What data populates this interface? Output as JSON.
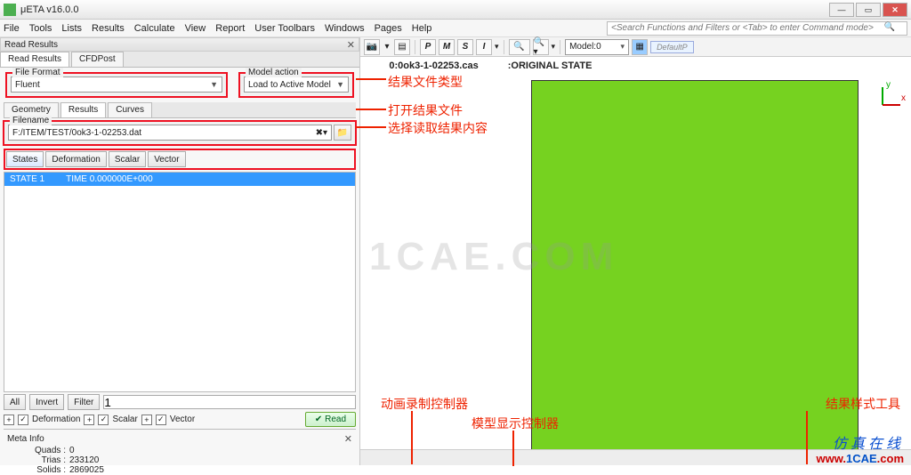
{
  "window": {
    "title": "μETA v16.0.0"
  },
  "menubar": {
    "items": [
      "File",
      "Tools",
      "Lists",
      "Results",
      "Calculate",
      "View",
      "Report",
      "User Toolbars",
      "Windows",
      "Pages",
      "Help"
    ],
    "search_placeholder": "<Search Functions and Filters or <Tab> to enter Command mode>"
  },
  "left_panel": {
    "header": "Read Results",
    "tabs": [
      "Read Results",
      "CFDPost"
    ],
    "file_format": {
      "label": "File Format",
      "value": "Fluent"
    },
    "model_action": {
      "label": "Model action",
      "value": "Load to Active Model"
    },
    "result_tabs": [
      "Geometry",
      "Results",
      "Curves"
    ],
    "filename_label": "Filename",
    "filename_value": "F:/ITEM/TEST/0ok3-1-02253.dat",
    "state_tabs": [
      "States",
      "Deformation",
      "Scalar",
      "Vector"
    ],
    "list_row": {
      "col1": "STATE 1",
      "col2": "TIME 0.000000E+000"
    },
    "filter_buttons": [
      "All",
      "Invert",
      "Filter"
    ],
    "filter_value": "1",
    "check_items": [
      "Deformation",
      "Scalar",
      "Vector"
    ],
    "read_button": "Read",
    "meta": {
      "title": "Meta Info",
      "rows": [
        {
          "label": "Quads :",
          "value": "0"
        },
        {
          "label": "Trias :",
          "value": "233120"
        },
        {
          "label": "Solids :",
          "value": "2869025"
        }
      ]
    }
  },
  "right_toolbar": {
    "model_label": "Model:0",
    "pill": "DefaultP"
  },
  "viewport": {
    "header_left": "0:0ok3-1-02253.cas",
    "header_right": ":ORIGINAL STATE",
    "axes": {
      "y": "y",
      "x": "x"
    },
    "watermark": "1CAE.COM"
  },
  "annotations": {
    "a1": "结果文件类型",
    "a2": "打开结果文件",
    "a3": "选择读取结果内容",
    "a4": "动画录制控制器",
    "a5": "模型显示控制器",
    "a6": "结果样式工具"
  },
  "credit": {
    "line1": "仿真在线",
    "line2a": "www.",
    "line2b": "1CAE",
    "line2c": ".com"
  }
}
